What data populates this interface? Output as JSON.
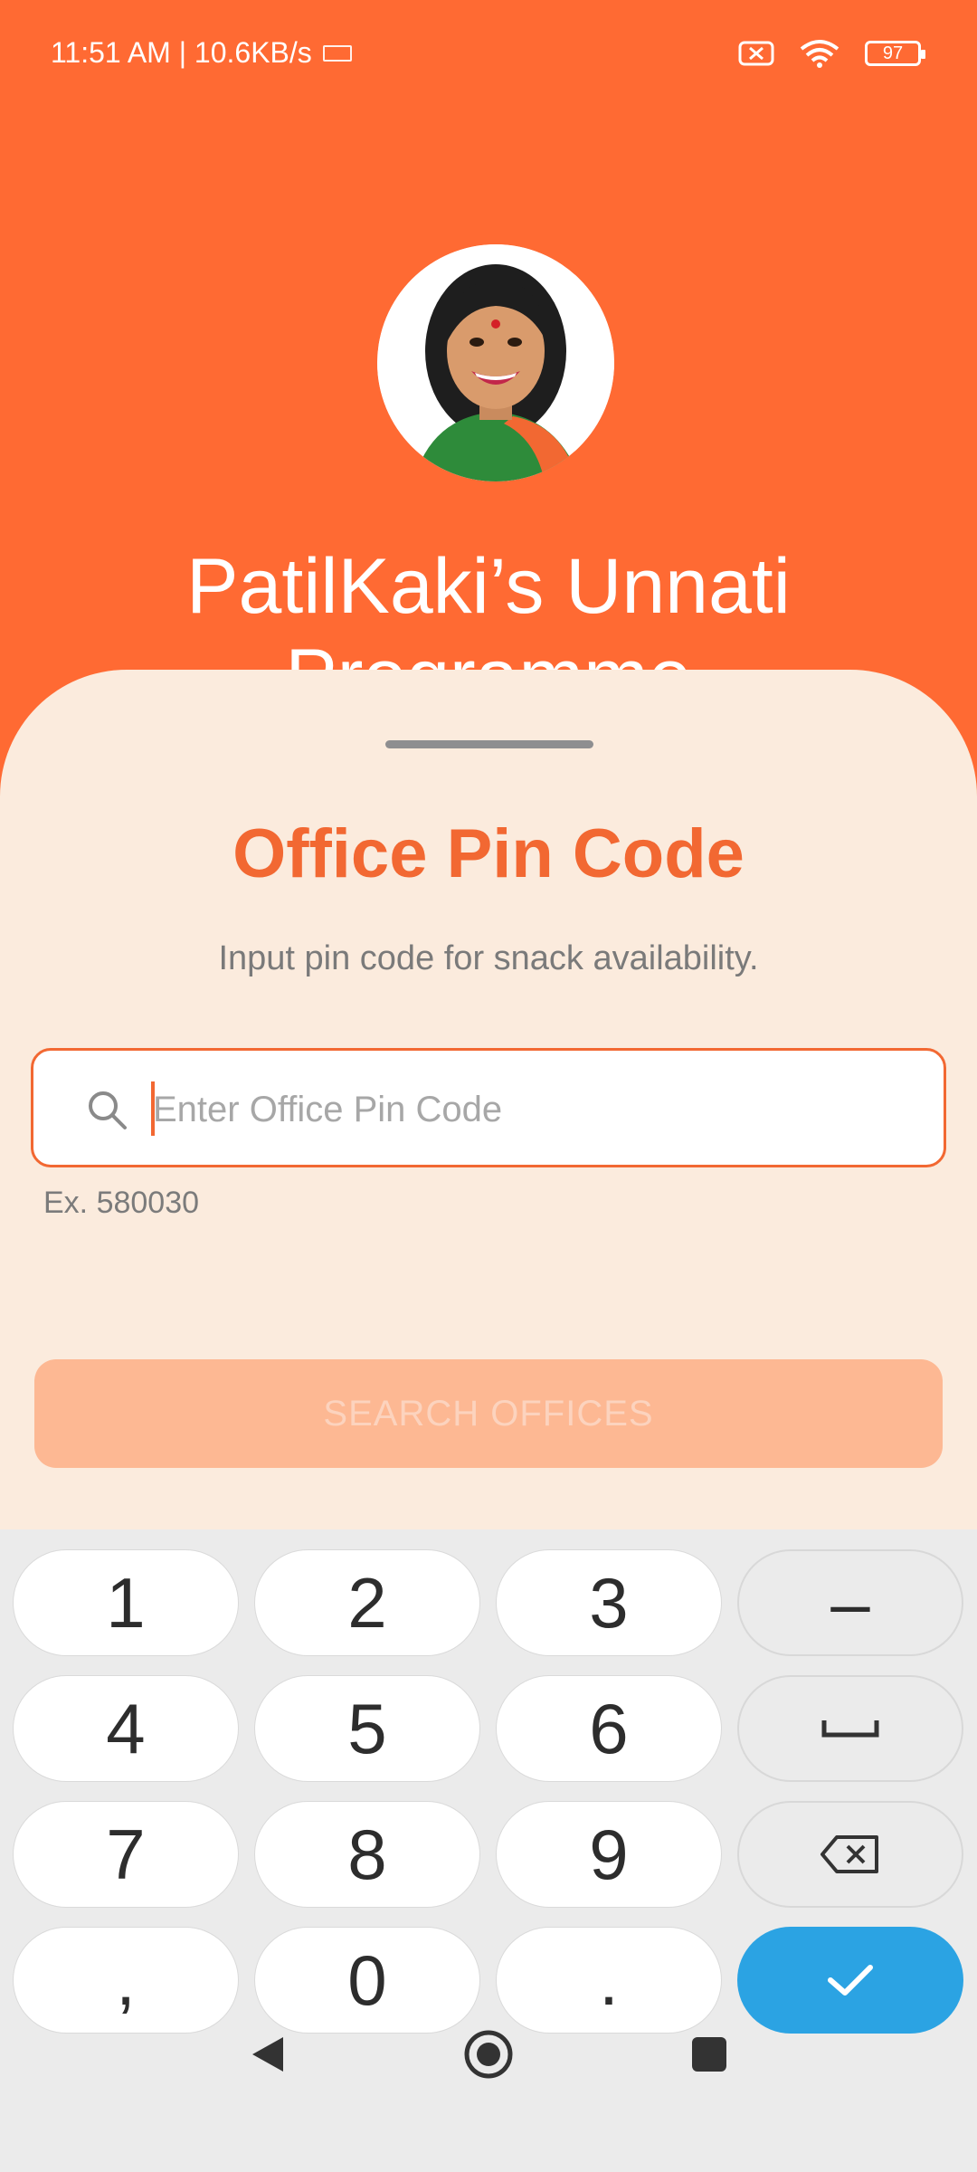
{
  "status_bar": {
    "time_speed": "11:51 AM | 10.6KB/s",
    "battery_level": "97",
    "icons": [
      "keyboard-icon",
      "sim-off-icon",
      "wifi-icon",
      "battery-icon"
    ]
  },
  "hero": {
    "title_line1": "PatilKaki’s Unnati",
    "title_line2": "Programme"
  },
  "sheet": {
    "title": "Office Pin Code",
    "subtitle": "Input pin code for snack availability.",
    "pin_input": {
      "value": "",
      "placeholder": "Enter Office Pin Code"
    },
    "hint": "Ex. 580030",
    "search_button_label": "SEARCH OFFICES"
  },
  "keyboard": {
    "keys": [
      "1",
      "2",
      "3",
      "4",
      "5",
      "6",
      "7",
      "8",
      "9",
      ",",
      "0",
      "."
    ],
    "function_keys": [
      "–",
      "space",
      "backspace",
      "done"
    ]
  },
  "colors": {
    "brand_orange": "#FF6A33",
    "title_orange": "#F26832",
    "sheet_bg": "#FBEBDD",
    "button_disabled": "#FDB893",
    "enter_blue": "#2BA3E3"
  }
}
